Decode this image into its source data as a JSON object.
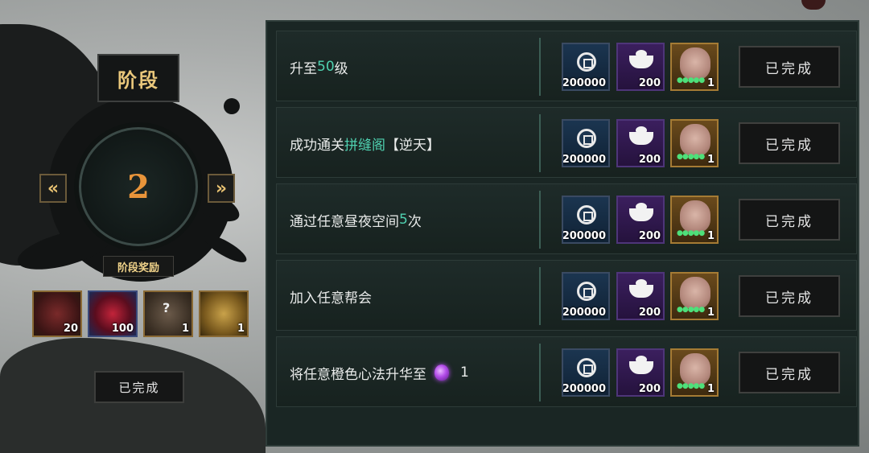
{
  "stage": {
    "title": "阶段",
    "number": "2",
    "prev_icon": "double-chevron-left-icon",
    "next_icon": "double-chevron-right-icon",
    "prev_label": "«",
    "next_label": "»",
    "rewards_label": "阶段奖励",
    "rewards": [
      {
        "icon": "flame-token-icon",
        "count": "20"
      },
      {
        "icon": "red-crystal-icon",
        "count": "100"
      },
      {
        "icon": "mystery-chest-icon",
        "count": "1"
      },
      {
        "icon": "gold-chest-icon",
        "count": "1"
      }
    ],
    "done_label": "已完成"
  },
  "tasks": [
    {
      "pre": "升至",
      "hl": "50",
      "post": "级",
      "extra": "",
      "count": ""
    },
    {
      "pre": "成功通关",
      "hl": "拼缝阁",
      "post": "【逆天】",
      "extra": "",
      "count": ""
    },
    {
      "pre": "通过任意昼夜空间",
      "hl": "5",
      "post": "次",
      "extra": "",
      "count": ""
    },
    {
      "pre": "加入任意帮会",
      "hl": "",
      "post": "",
      "extra": "",
      "count": ""
    },
    {
      "pre": "将任意橙色心法升华至",
      "hl": "",
      "post": "",
      "extra": "purple-orb-icon",
      "count": "1"
    }
  ],
  "task_rewards": {
    "coin": "200000",
    "ingot": "200",
    "bag": "1"
  },
  "done_label": "已完成",
  "colors": {
    "highlight": "#4fd1b0",
    "gold": "#e9c77b",
    "stage_number": "#e8943a"
  }
}
